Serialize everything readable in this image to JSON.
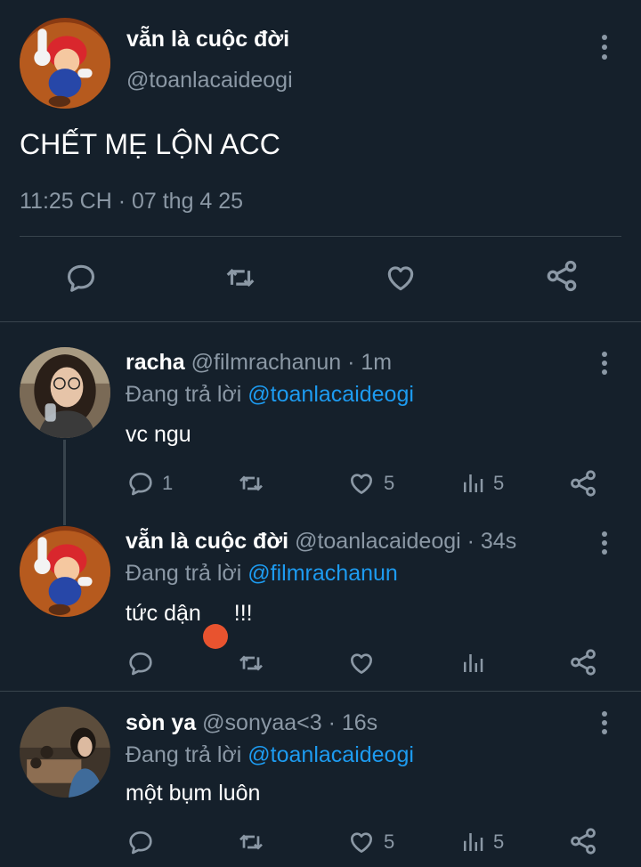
{
  "main_tweet": {
    "display_name": "vẵn là cuộc đời",
    "handle": "@toanlacaideogi",
    "text": "CHẾT MẸ LỘN ACC",
    "timestamp": "11:25 CH · 07 thg 4 25"
  },
  "replies": [
    {
      "display_name": "racha",
      "handle_time": "@filmrachanun · 1m",
      "replying_label": "Đang trả lời",
      "replying_to": "@toanlacaideogi",
      "text": "vc ngu",
      "reply_count": "1",
      "like_count": "5",
      "view_count": "5"
    },
    {
      "display_name": "vẵn là cuộc đời",
      "handle_time": "@toanlacaideogi · 34s",
      "replying_label": "Đang trả lời",
      "replying_to": "@filmrachanun",
      "text": "tức dận",
      "emoji": "😡",
      "text_after": " !!!"
    },
    {
      "display_name": "sòn ya",
      "handle_time": "@sonyaa<3 · 16s",
      "replying_label": "Đang trả lời",
      "replying_to": "@toanlacaideogi",
      "text": "một bụm luôn",
      "like_count": "5",
      "view_count": "5"
    }
  ],
  "icons": [
    "reply-icon",
    "retweet-icon",
    "like-icon",
    "share-icon",
    "views-icon",
    "more-icon"
  ],
  "colors": {
    "background": "#15202b",
    "muted": "#8b98a5",
    "link": "#1d9bf0",
    "divider": "#38444d"
  }
}
